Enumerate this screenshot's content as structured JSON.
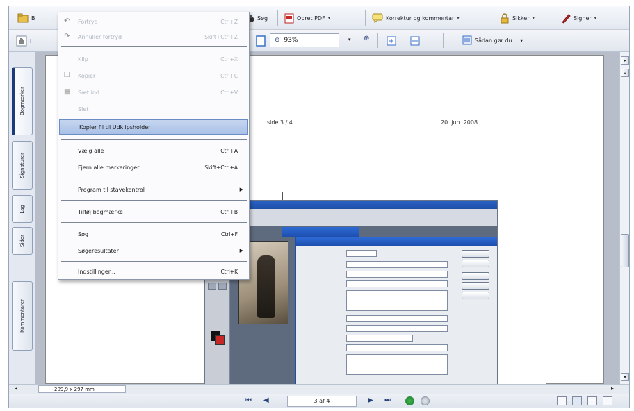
{
  "window": {
    "background": "#eef1f6"
  },
  "toolbar": {
    "partial_first_label": "B",
    "search_label": "Søg",
    "create_pdf_label": "Opret PDF",
    "review_label": "Korrektur og kommentar",
    "secure_label": "Sikker",
    "sign_label": "Signer",
    "zoom_value": "93%",
    "partial_left_label": "I",
    "sheet_label": "Sådan gør du..."
  },
  "edit_menu": {
    "items": [
      {
        "label": "Fortryd",
        "shortcut": "Ctrl+Z",
        "state": "disabled",
        "icon": "undo-icon"
      },
      {
        "label": "Annuller fortryd",
        "shortcut": "Skift+Ctrl+Z",
        "state": "disabled",
        "icon": "redo-icon"
      },
      {
        "label": "Klip",
        "shortcut": "Ctrl+X",
        "state": "disabled",
        "icon": ""
      },
      {
        "label": "Kopier",
        "shortcut": "Ctrl+C",
        "state": "disabled",
        "icon": "copy-icon"
      },
      {
        "label": "Sæt ind",
        "shortcut": "Ctrl+V",
        "state": "disabled",
        "icon": "paste-icon"
      },
      {
        "label": "Slet",
        "shortcut": "",
        "state": "disabled",
        "icon": ""
      },
      {
        "label": "Kopier fil til Udklipsholder",
        "shortcut": "",
        "state": "highlighted",
        "icon": ""
      },
      {
        "label": "Vælg alle",
        "shortcut": "Ctrl+A",
        "state": "enabled",
        "icon": ""
      },
      {
        "label": "Fjern alle markeringer",
        "shortcut": "Skift+Ctrl+A",
        "state": "enabled",
        "icon": ""
      },
      {
        "label": "Program til stavekontrol",
        "shortcut": "",
        "state": "submenu",
        "icon": ""
      },
      {
        "label": "Tilføj bogmærke",
        "shortcut": "Ctrl+B",
        "state": "enabled",
        "icon": ""
      },
      {
        "label": "Søg",
        "shortcut": "Ctrl+F",
        "state": "enabled",
        "icon": ""
      },
      {
        "label": "Søgeresultater",
        "shortcut": "",
        "state": "submenu",
        "icon": ""
      },
      {
        "label": "Indstillinger...",
        "shortcut": "Ctrl+K",
        "state": "enabled",
        "icon": ""
      }
    ]
  },
  "nav_tabs": [
    "Bogmærker",
    "Signaturer",
    "Lag",
    "Sider",
    "Kommentarer"
  ],
  "page": {
    "header_left": "side 3 / 4",
    "header_right": "20. jun. 2008"
  },
  "statusbar": {
    "page_size": "209,9 x 297 mm",
    "page_indicator": "3 af 4"
  },
  "colors": {
    "highlight": "#a9c0e6",
    "accent": "#1c3b7a",
    "pdf_red": "#c62828"
  }
}
